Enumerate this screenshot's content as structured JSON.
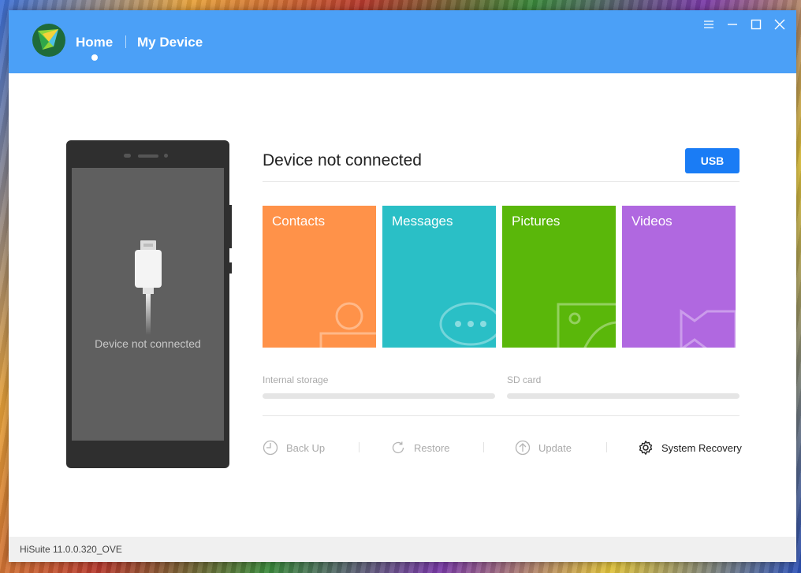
{
  "nav": {
    "home_label": "Home",
    "device_label": "My Device"
  },
  "window_controls": [
    "menu-icon",
    "minimize-icon",
    "maximize-icon",
    "close-icon"
  ],
  "phone": {
    "status": "Device not connected"
  },
  "main": {
    "title": "Device not connected",
    "usb_button": "USB"
  },
  "tiles": [
    {
      "label": "Contacts",
      "color": "#ff9249",
      "icon": "contact-icon"
    },
    {
      "label": "Messages",
      "color": "#2abfc6",
      "icon": "chat-bubble-icon"
    },
    {
      "label": "Pictures",
      "color": "#5ab70a",
      "icon": "picture-icon"
    },
    {
      "label": "Videos",
      "color": "#b068e0",
      "icon": "video-camera-icon"
    }
  ],
  "storage": {
    "internal_label": "Internal storage",
    "sd_label": "SD card"
  },
  "actions": [
    {
      "label": "Back Up",
      "icon": "backup-clock-icon",
      "enabled": false
    },
    {
      "label": "Restore",
      "icon": "restore-icon",
      "enabled": false
    },
    {
      "label": "Update",
      "icon": "update-arrow-icon",
      "enabled": false
    },
    {
      "label": "System Recovery",
      "icon": "gear-icon",
      "enabled": true
    }
  ],
  "statusbar": {
    "version": "HiSuite 11.0.0.320_OVE"
  },
  "colors": {
    "titlebar": "#4ba0f7",
    "usb_button": "#1a7cf5"
  }
}
